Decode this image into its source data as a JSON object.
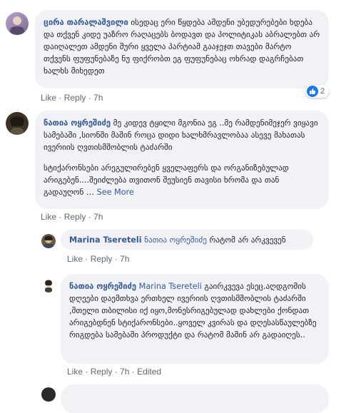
{
  "comments": [
    {
      "author": "ცირა თარალაშვილი",
      "text": " ისედაც ერი წყდება ამდენი უბედურებები ხდება და თქვენ კიდე უაზრო რაღაცებს ბოდავთ და პოლიტიკას აბრალებთ არ დაიღალეთ ამდენი შური ყველა პარტიამ გააჯეჯთ თავები მარტო თქვენს ფუფუნებაზე ნუ ფიქრობთ ეგ ფუფუნებაც ოხრად დაგრჩებათ ხალხს მიხედეთ",
      "like": "Like",
      "reply": "Reply",
      "time": "7h",
      "reactions": "2"
    },
    {
      "author": "ნათია ოყრეშიძე",
      "text": " მე კიდევ ტყილი მგონია ეგ ..მე რამდენიმეჯერ ვიყავი სამებაში ,სიონში მაშინ როცა დიდი ხალხმრავლობაა ასევე მახათას ივერიის ღვთისმშობლის ტაძარში",
      "text2": "სტიქარონსები არეგულირებენ ყველაფერს და ორგანიზებულად არიგებენ....შეიძლება თვითონ შეუსიენ თავისი ხრომა და თან გადაუღონ …",
      "see_more": "See More",
      "like": "Like",
      "reply": "Reply",
      "time": "7h"
    },
    {
      "author": "Marina Tsereteli",
      "mention": "ნათია ოყრეშიძე",
      "text": " რატომ არ არკვევენ",
      "like": "Like",
      "reply": "Reply",
      "time": "7h"
    },
    {
      "author": "ნათია ოყრეშიძე",
      "mention": "Marina Tsereteli",
      "text": " გაირკვევა ესეც.აღდგომის დღეები დაემთხვა ერთხელ ივერიის ღვთისმშობლის ტაძარში ,მთელი თბილისი იქ იყო,მონესრიგებულად დახლები ქონდათ არიგებდნენ სტიქარონსები..ყოველ კვირას და დღესასწაულებზე რიგდება სამებაში პროდუქტი და რატომ მაშინ არ გადაიღეს..",
      "like": "Like",
      "reply": "Reply",
      "time": "7h",
      "edited": "Edited"
    }
  ],
  "separator": " · ",
  "colors": {
    "bubble": "#f0f2f5",
    "name": "#385898",
    "meta": "#606770",
    "like_blue": "#1877f2"
  },
  "icons": [
    "avatar-circle",
    "like-icon"
  ]
}
